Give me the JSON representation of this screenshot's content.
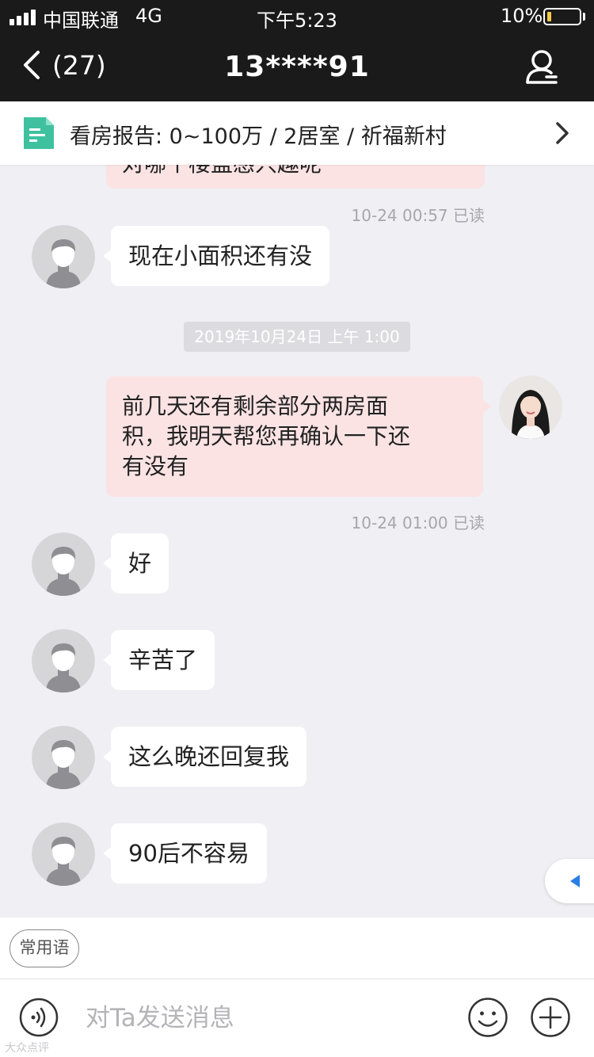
{
  "status_bar": {
    "carrier": "中国联通",
    "network": "4G",
    "time": "下午5:23",
    "battery": "10%"
  },
  "nav": {
    "back_count": "(27)",
    "title": "13****91"
  },
  "report": {
    "label": "看房报告: 0~100万 / 2居室 / 祈福新村"
  },
  "chat": {
    "partial_msg": "对哪个楼盘感兴趣呢",
    "meta1": "10-24 00:57 已读",
    "msg_left_1": "现在小面积还有没",
    "date_divider": "2019年10月24日 上午 1:00",
    "msg_right_lines": [
      "前几天还有剩余部分两房面",
      "积，我明天帮您再确认一下还",
      "有没有"
    ],
    "meta2": "10-24 01:00 已读",
    "msg_left_2": "好",
    "msg_left_3": "辛苦了",
    "msg_left_4": "这么晚还回复我",
    "msg_left_5": "90后不容易"
  },
  "quick": {
    "label": "常用语"
  },
  "input": {
    "placeholder": "对Ta发送消息"
  },
  "watermark": "大众点评",
  "icons": {
    "back": "chevron-left-icon",
    "profile": "user-profile-icon",
    "report": "document-icon",
    "report_chevron": "chevron-right-icon",
    "voice": "voice-icon",
    "emoji": "smiley-icon",
    "plus": "plus-circle-icon"
  },
  "colors": {
    "header_bg": "#1a1a1a",
    "chat_bg": "#efeff4",
    "outgoing_bubble": "#fbe3e4",
    "incoming_bubble": "#ffffff",
    "doc_icon": "#3fc1a0",
    "battery_low": "#f7c948"
  }
}
